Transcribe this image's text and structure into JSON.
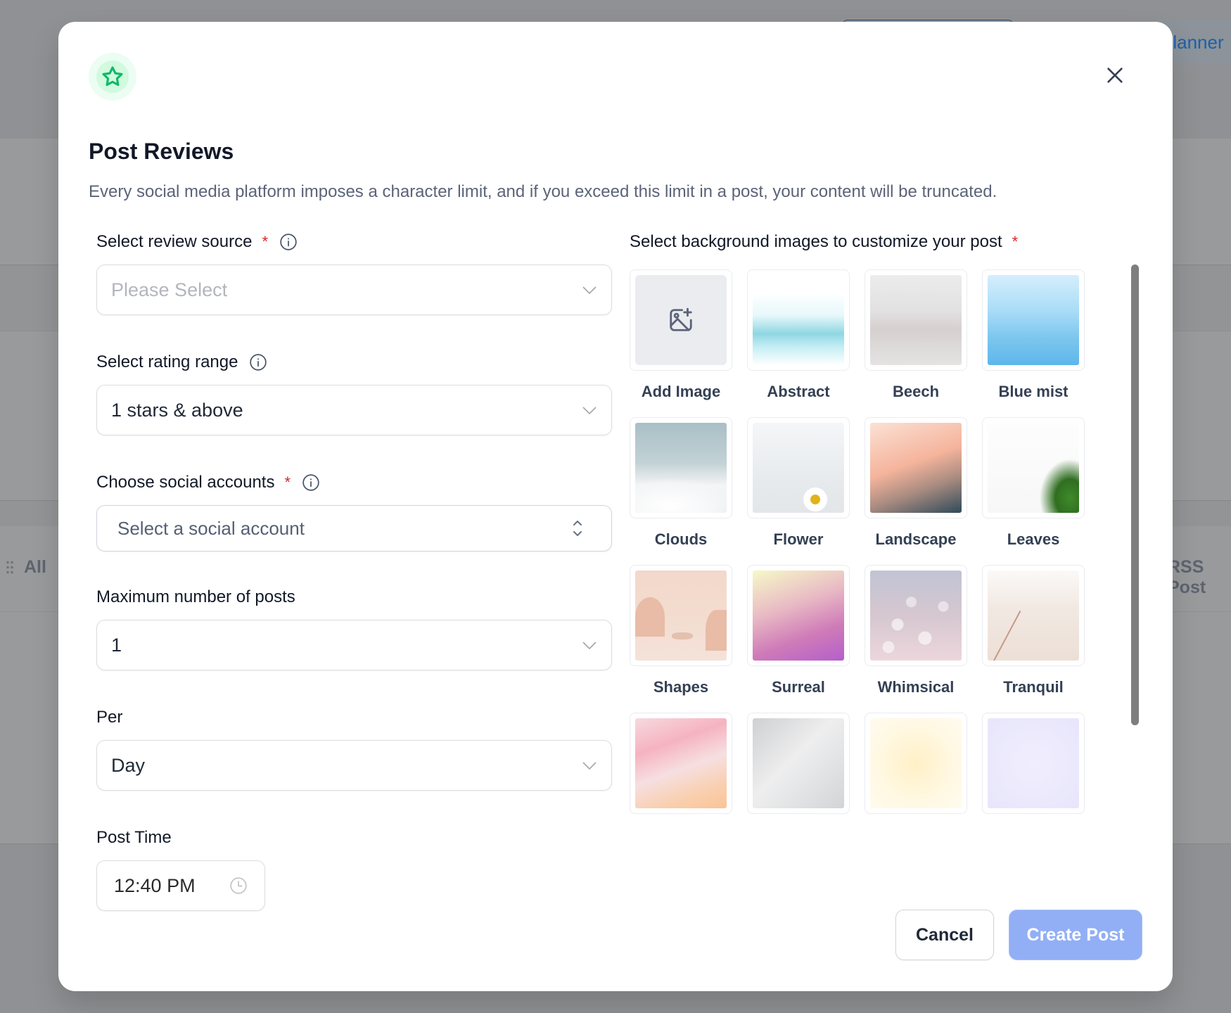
{
  "background_page": {
    "planner_button_label": "Planner",
    "filter_all_label": "All",
    "rss_post_label": "RSS Post"
  },
  "modal": {
    "icon": "star-icon",
    "title": "Post Reviews",
    "description": "Every social media platform imposes a character limit, and if you exceed this limit in a post, your content will be truncated.",
    "close_icon": "close-icon",
    "colors": {
      "icon_green": "#12b76a",
      "icon_bg": "#ecfdf3",
      "required": "#dc2626",
      "primary_disabled": "#92aff6"
    }
  },
  "form": {
    "review_source": {
      "label": "Select review source",
      "required": "*",
      "placeholder": "Please Select",
      "value": ""
    },
    "rating_range": {
      "label": "Select rating range",
      "value": "1 stars & above"
    },
    "social_accounts": {
      "label": "Choose social accounts",
      "required": "*",
      "placeholder": "Select a social account"
    },
    "max_posts": {
      "label": "Maximum number of posts",
      "value": "1"
    },
    "per": {
      "label": "Per",
      "value": "Day"
    },
    "post_time": {
      "label": "Post Time",
      "value": "12:40 PM"
    }
  },
  "backgrounds": {
    "label": "Select background images to customize your post",
    "required": "*",
    "items": [
      {
        "label": "Add Image",
        "kind": "add"
      },
      {
        "label": "Abstract"
      },
      {
        "label": "Beech"
      },
      {
        "label": "Blue mist"
      },
      {
        "label": "Clouds"
      },
      {
        "label": "Flower"
      },
      {
        "label": "Landscape"
      },
      {
        "label": "Leaves"
      },
      {
        "label": "Shapes"
      },
      {
        "label": "Surreal"
      },
      {
        "label": "Whimsical"
      },
      {
        "label": "Tranquil"
      },
      {
        "label": ""
      },
      {
        "label": ""
      },
      {
        "label": ""
      },
      {
        "label": ""
      }
    ]
  },
  "footer": {
    "cancel_label": "Cancel",
    "create_label": "Create Post"
  }
}
